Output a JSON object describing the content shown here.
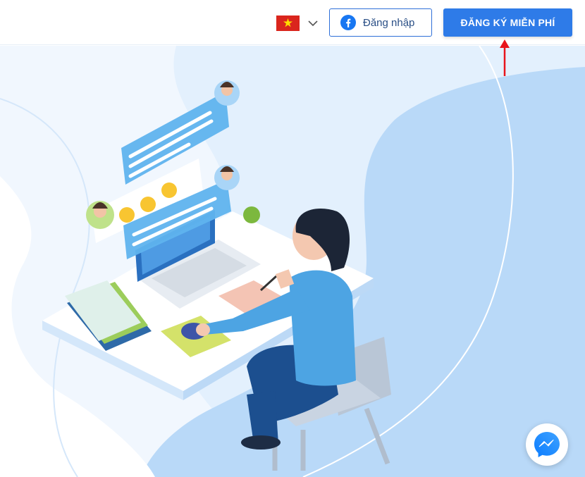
{
  "header": {
    "language": {
      "flag": "vietnam-flag",
      "selected": "vi"
    },
    "facebook_login": {
      "label": "Đăng nhập",
      "icon": "facebook-icon"
    },
    "signup": {
      "label": "ĐĂNG KÝ MIỄN PHÍ"
    }
  },
  "hero": {
    "illustration": "person-working-at-laptop-with-chat-bubbles"
  },
  "chat_widget": {
    "icon": "messenger-icon"
  },
  "colors": {
    "primary": "#2e7be8",
    "facebook_text": "#2a4f86",
    "hero_light": "#e3f0fd",
    "hero_blob": "#b9d9f8",
    "arrow": "#e8141c"
  }
}
